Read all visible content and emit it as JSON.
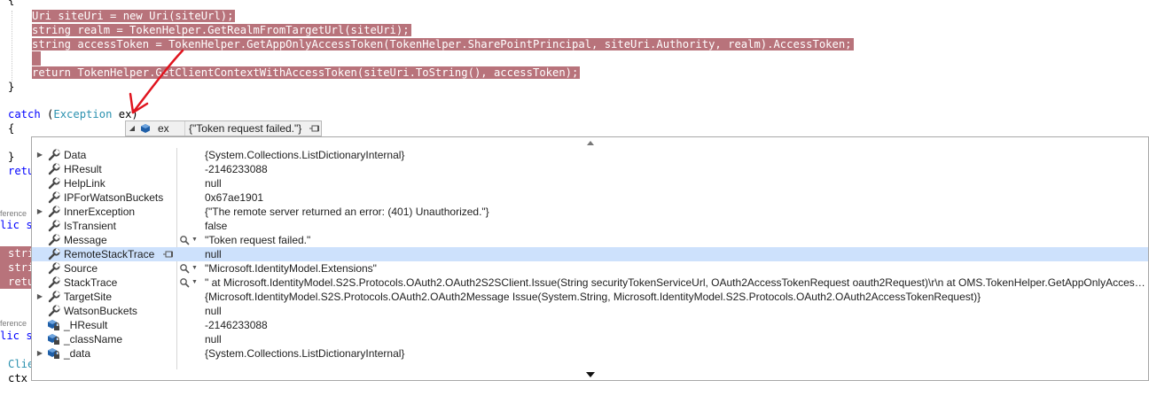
{
  "code": {
    "line_brace_top": "{",
    "line1": "Uri siteUri = new Uri(siteUrl);",
    "line2": "string realm = TokenHelper.GetRealmFromTargetUrl(siteUri);",
    "line3": "string accessToken = TokenHelper.GetAppOnlyAccessToken(TokenHelper.SharePointPrincipal, siteUri.Authority, realm).AccessToken;",
    "line4": "return TokenHelper.GetClientContextWithAccessToken(siteUri.ToString(), accessToken);",
    "line5": "}",
    "catch_kw": "catch",
    "catch_open": " (",
    "catch_type": "Exception",
    "catch_var": " ex)",
    "brace_open": "{",
    "brace_close": "}",
    "retu": "retu",
    "ference1": "ference",
    "lic_s1": "lic s",
    "stri1": "stri",
    "stri2": "stri",
    "retu2": "retu",
    "ference2": "ference",
    "lic_s2": "lic s",
    "clie": "Clie",
    "ctx": "ctx"
  },
  "datatip": {
    "name": "ex",
    "value": "{\"Token request failed.\"}",
    "rows": [
      {
        "name": "Data",
        "value": "{System.Collections.ListDictionaryInternal}",
        "expandable": true,
        "icon": "wrench-icon"
      },
      {
        "name": "HResult",
        "value": "-2146233088",
        "expandable": false,
        "icon": "wrench-icon"
      },
      {
        "name": "HelpLink",
        "value": "null",
        "expandable": false,
        "icon": "wrench-icon"
      },
      {
        "name": "IPForWatsonBuckets",
        "value": "0x67ae1901",
        "expandable": false,
        "icon": "wrench-icon"
      },
      {
        "name": "InnerException",
        "value": "{\"The remote server returned an error: (401) Unauthorized.\"}",
        "expandable": true,
        "icon": "wrench-icon"
      },
      {
        "name": "IsTransient",
        "value": "false",
        "expandable": false,
        "icon": "wrench-icon"
      },
      {
        "name": "Message",
        "value": "\"Token request failed.\"",
        "expandable": false,
        "icon": "wrench-icon",
        "viz": true
      },
      {
        "name": "RemoteStackTrace",
        "value": "null",
        "expandable": false,
        "icon": "wrench-icon",
        "selected": true,
        "pin": true
      },
      {
        "name": "Source",
        "value": "\"Microsoft.IdentityModel.Extensions\"",
        "expandable": false,
        "icon": "wrench-icon",
        "viz": true
      },
      {
        "name": "StackTrace",
        "value": "\"   at Microsoft.IdentityModel.S2S.Protocols.OAuth2.OAuth2S2SClient.Issue(String securityTokenServiceUrl, OAuth2AccessTokenRequest oauth2Request)\\r\\n   at OMS.TokenHelper.GetAppOnlyAccessTo...",
        "expandable": false,
        "icon": "wrench-icon",
        "viz": true
      },
      {
        "name": "TargetSite",
        "value": "{Microsoft.IdentityModel.S2S.Protocols.OAuth2.OAuth2Message Issue(System.String, Microsoft.IdentityModel.S2S.Protocols.OAuth2.OAuth2AccessTokenRequest)}",
        "expandable": true,
        "icon": "wrench-icon"
      },
      {
        "name": "WatsonBuckets",
        "value": "null",
        "expandable": false,
        "icon": "wrench-icon"
      },
      {
        "name": "_HResult",
        "value": "-2146233088",
        "expandable": false,
        "icon": "private-field-icon"
      },
      {
        "name": "_className",
        "value": "null",
        "expandable": false,
        "icon": "private-field-icon"
      },
      {
        "name": "_data",
        "value": "{System.Collections.ListDictionaryInternal}",
        "expandable": true,
        "icon": "private-field-icon"
      }
    ]
  },
  "colors": {
    "highlight": "#b8737b",
    "selected_row": "#cde1fc",
    "arrow": "#e0141e",
    "keyword": "#0000ff",
    "type": "#2b91af"
  }
}
